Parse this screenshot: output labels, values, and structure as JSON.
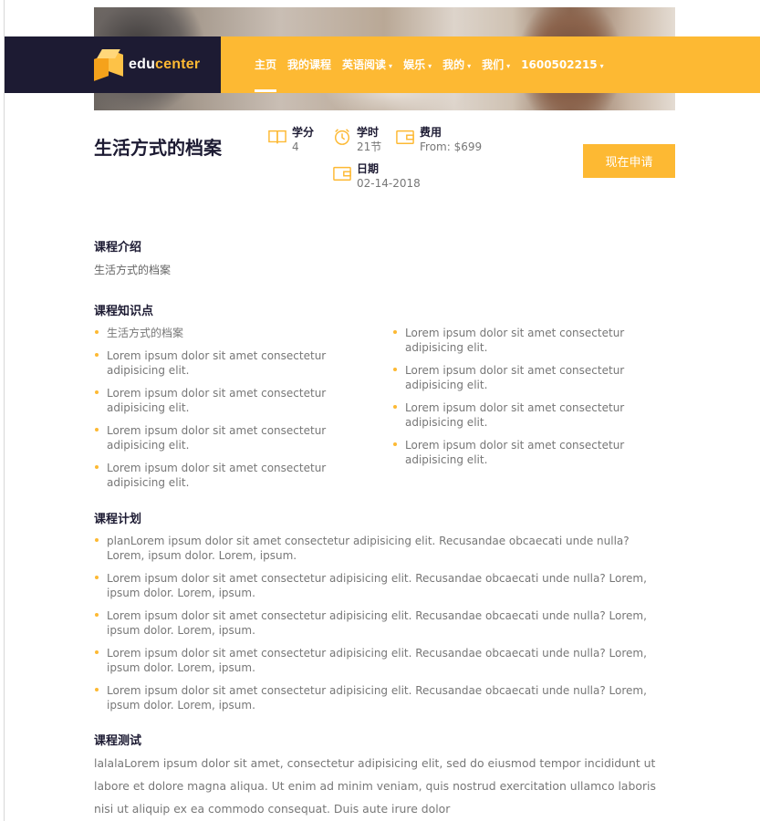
{
  "brand": {
    "logo_main": "edu",
    "logo_accent": "center",
    "accent_color": "#fdb933",
    "dark_color": "#1d1b33"
  },
  "nav": {
    "items": [
      {
        "label": "主页",
        "dropdown": false
      },
      {
        "label": "我的课程",
        "dropdown": false
      },
      {
        "label": "英语阅读",
        "dropdown": true
      },
      {
        "label": "娱乐",
        "dropdown": true
      },
      {
        "label": "我的",
        "dropdown": true
      },
      {
        "label": "我们",
        "dropdown": true
      },
      {
        "label": "1600502215",
        "dropdown": true
      }
    ]
  },
  "course": {
    "title": "生活方式的档案",
    "credits": {
      "label": "学分",
      "value": "4",
      "icon": "book-icon"
    },
    "hours": {
      "label": "学时",
      "value": "21节",
      "icon": "clock-icon"
    },
    "fee": {
      "label": "费用",
      "value": "From: $699",
      "icon": "wallet-icon"
    },
    "date": {
      "label": "日期",
      "value": "02-14-2018",
      "icon": "calendar-icon"
    },
    "apply_label": "现在申请"
  },
  "intro": {
    "title": "课程介绍",
    "text": "生活方式的档案"
  },
  "knowledge": {
    "title": "课程知识点",
    "left": [
      "生活方式的档案",
      "Lorem ipsum dolor sit amet consectetur adipisicing elit.",
      "Lorem ipsum dolor sit amet consectetur adipisicing elit.",
      "Lorem ipsum dolor sit amet consectetur adipisicing elit.",
      "Lorem ipsum dolor sit amet consectetur adipisicing elit."
    ],
    "right": [
      "Lorem ipsum dolor sit amet consectetur adipisicing elit.",
      "Lorem ipsum dolor sit amet consectetur adipisicing elit.",
      "Lorem ipsum dolor sit amet consectetur adipisicing elit.",
      "Lorem ipsum dolor sit amet consectetur adipisicing elit."
    ]
  },
  "plan": {
    "title": "课程计划",
    "items": [
      "planLorem ipsum dolor sit amet consectetur adipisicing elit. Recusandae obcaecati unde nulla? Lorem, ipsum dolor. Lorem, ipsum.",
      "Lorem ipsum dolor sit amet consectetur adipisicing elit. Recusandae obcaecati unde nulla? Lorem, ipsum dolor. Lorem, ipsum.",
      "Lorem ipsum dolor sit amet consectetur adipisicing elit. Recusandae obcaecati unde nulla? Lorem, ipsum dolor. Lorem, ipsum.",
      "Lorem ipsum dolor sit amet consectetur adipisicing elit. Recusandae obcaecati unde nulla? Lorem, ipsum dolor. Lorem, ipsum.",
      "Lorem ipsum dolor sit amet consectetur adipisicing elit. Recusandae obcaecati unde nulla? Lorem, ipsum dolor. Lorem, ipsum."
    ]
  },
  "test": {
    "title": "课程测试",
    "text": "lalalaLorem ipsum dolor sit amet, consectetur adipisicing elit, sed do eiusmod tempor incididunt ut labore et dolore magna aliqua. Ut enim ad minim veniam, quis nostrud exercitation ullamco laboris nisi ut aliquip ex ea commodo consequat. Duis aute irure dolor"
  }
}
